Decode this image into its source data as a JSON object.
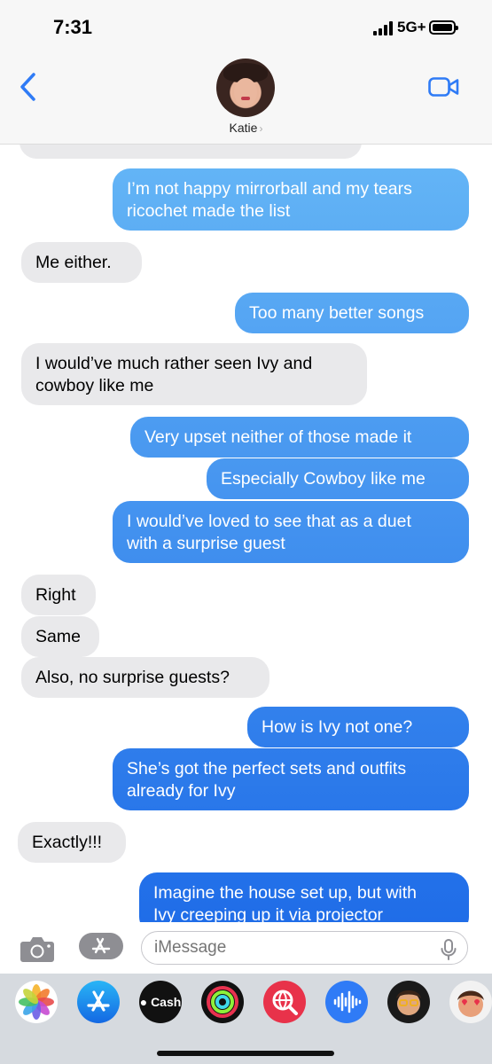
{
  "status_bar": {
    "time": "7:31",
    "network": "5G+",
    "battery_level": 1.0
  },
  "header": {
    "contact_name": "Katie",
    "contact_chevron": "›",
    "back_icon": "chevron-left-icon",
    "video_icon": "video-camera-icon"
  },
  "colors": {
    "incoming_bubble": "#e9e9eb",
    "outgoing_gradient_top": "#65b6f6",
    "outgoing_gradient_bottom": "#1f6ce8",
    "tint": "#2f7bf6"
  },
  "messages": [
    {
      "from": "them",
      "text": "",
      "partial": true
    },
    {
      "from": "me",
      "lines": [
        "I’m not happy mirrorball and my tears",
        "ricochet made the list"
      ]
    },
    {
      "from": "them",
      "lines": [
        "Me either."
      ]
    },
    {
      "from": "me",
      "lines": [
        "Too many better songs"
      ]
    },
    {
      "from": "them",
      "lines": [
        "I would’ve much rather seen Ivy and",
        "cowboy like me"
      ]
    },
    {
      "from": "me",
      "lines": [
        "Very upset neither of those made it"
      ]
    },
    {
      "from": "me",
      "lines": [
        "Especially Cowboy like me"
      ]
    },
    {
      "from": "me",
      "lines": [
        "I would’ve loved to see that as a duet",
        "with a surprise guest"
      ]
    },
    {
      "from": "them",
      "lines": [
        "Right"
      ]
    },
    {
      "from": "them",
      "lines": [
        "Same"
      ]
    },
    {
      "from": "them",
      "lines": [
        "Also, no surprise guests?"
      ]
    },
    {
      "from": "me",
      "lines": [
        "How is Ivy not one?"
      ]
    },
    {
      "from": "me",
      "lines": [
        "She’s got the perfect sets and outfits",
        "already for Ivy"
      ]
    },
    {
      "from": "them",
      "lines": [
        "Exactly!!!"
      ]
    },
    {
      "from": "me",
      "lines": [
        "Imagine the house set up, but with",
        "Ivy creeping up it via projector"
      ],
      "partial": true
    }
  ],
  "compose": {
    "placeholder": "iMessage",
    "camera_icon": "camera-icon",
    "apps_icon": "app-store-icon",
    "mic_icon": "microphone-icon"
  },
  "app_drawer": [
    {
      "name": "photos-app-icon"
    },
    {
      "name": "app-store-app-icon"
    },
    {
      "name": "apple-cash-app-icon",
      "label": "Cash"
    },
    {
      "name": "fitness-app-icon"
    },
    {
      "name": "web-images-app-icon"
    },
    {
      "name": "audio-message-app-icon"
    },
    {
      "name": "memoji-app-icon"
    },
    {
      "name": "memoji-stickers-app-icon"
    }
  ]
}
